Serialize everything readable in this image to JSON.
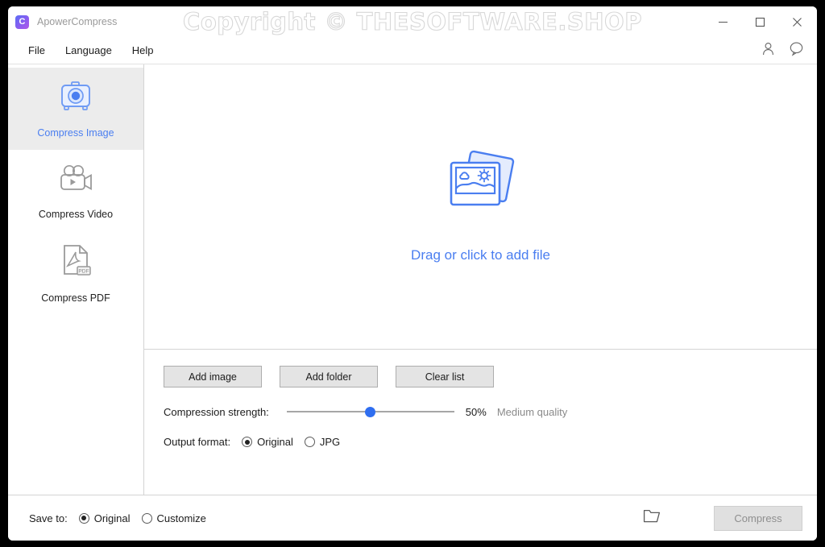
{
  "window": {
    "app_title": "ApowerCompress",
    "logo_letter": "C",
    "watermark": "Copyright © THESOFTWARE.SHOP",
    "controls": {
      "minimize": "minimize-button",
      "maximize": "maximize-button",
      "close": "close-button"
    }
  },
  "menubar": {
    "items": [
      {
        "label": "File"
      },
      {
        "label": "Language"
      },
      {
        "label": "Help"
      }
    ],
    "account_icon": "person-icon",
    "feedback_icon": "speech-bubble-icon"
  },
  "sidebar": {
    "items": [
      {
        "label": "Compress Image",
        "icon": "camera-icon",
        "active": true
      },
      {
        "label": "Compress Video",
        "icon": "video-camera-icon",
        "active": false
      },
      {
        "label": "Compress PDF",
        "icon": "pdf-file-icon",
        "active": false
      }
    ]
  },
  "dropzone": {
    "icon": "photos-stack-icon",
    "text": "Drag or click to add file"
  },
  "controls": {
    "buttons": [
      {
        "label": "Add image"
      },
      {
        "label": "Add folder"
      },
      {
        "label": "Clear list"
      }
    ],
    "compression": {
      "label": "Compression strength:",
      "percent": "50%",
      "quality": "Medium quality",
      "value": 50
    },
    "output_format": {
      "label": "Output format:",
      "options": [
        {
          "label": "Original",
          "selected": true
        },
        {
          "label": "JPG",
          "selected": false
        }
      ]
    }
  },
  "bottombar": {
    "save_to_label": "Save to:",
    "options": [
      {
        "label": "Original",
        "selected": true
      },
      {
        "label": "Customize",
        "selected": false
      }
    ],
    "folder_icon": "folder-icon",
    "compress_label": "Compress"
  },
  "colors": {
    "accent": "#4a7ef0",
    "slider": "#2f6ef0",
    "sidebar_active_bg": "#ececec"
  }
}
